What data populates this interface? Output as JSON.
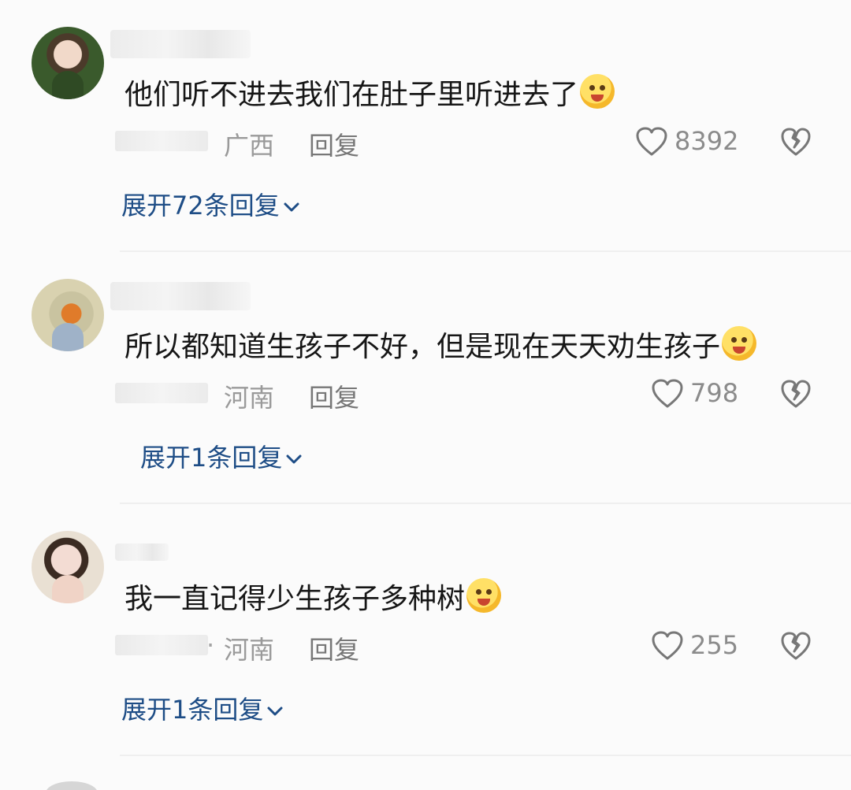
{
  "comments": [
    {
      "text": "他们听不进去我们在肚子里听进去了",
      "emoji": "tongue-wink-emoji",
      "region": "广西",
      "reply_label": "回复",
      "likes": "8392",
      "expand_label": "展开72条回复"
    },
    {
      "text": "所以都知道生孩子不好，但是现在天天劝生孩子",
      "emoji": "dizzy-smile-emoji",
      "region": "河南",
      "reply_label": "回复",
      "likes": "798",
      "expand_label": "展开1条回复"
    },
    {
      "text": "我一直记得少生孩子多种树",
      "emoji": "teary-eyes-emoji",
      "region": "河南",
      "reply_label": "回复",
      "likes": "255",
      "expand_label": "展开1条回复"
    }
  ],
  "meta_separator": "·",
  "colors": {
    "background": "#fbfbfb",
    "text": "#161616",
    "meta": "#8f8f8f",
    "expand_link": "#1e4d86"
  }
}
